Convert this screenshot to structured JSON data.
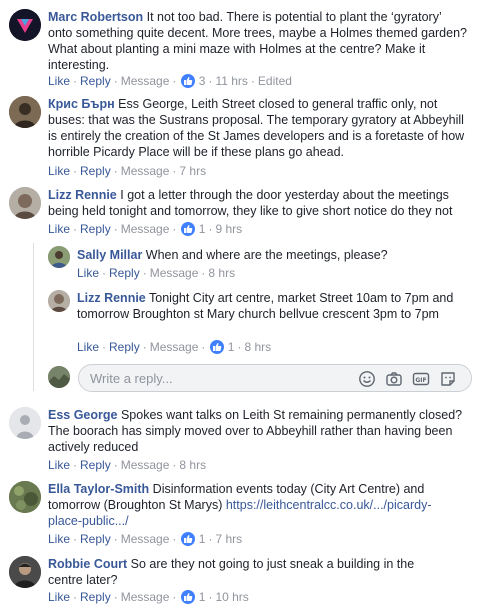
{
  "actions": {
    "like": "Like",
    "reply": "Reply",
    "message": "Message"
  },
  "comments": [
    {
      "author": "Marc Robertson",
      "text": "It not too bad. There is potential to plant the ‘gyratory’ onto something quite decent. More trees, maybe a Holmes themed garden? What about planting a mini maze with Holmes at the centre? Make it interesting.",
      "likes": "3",
      "time": "11 hrs",
      "edited": "Edited"
    },
    {
      "author": "Крис Бърн",
      "text": "Ess George, Leith Street closed to general traffic only, not buses: that was the Sustrans proposal. The temporary gyratory at Abbeyhill is entirely the creation of the St James developers and is a foretaste of how horrible Picardy Place will be if these plans go ahead.",
      "time": "7 hrs"
    },
    {
      "author": "Lizz Rennie",
      "text": "I got a letter through the door yesterday about the meetings being held tonight and tomorrow, they like to give short notice do they not",
      "likes": "1",
      "time": "9 hrs"
    },
    {
      "author": "Ess George",
      "text": "Spokes want talks on Leith St remaining permanently closed? The boorach has simply moved over to Abbeyhill rather than having been actively reduced",
      "time": "8 hrs"
    },
    {
      "author": "Ella Taylor-Smith",
      "text": "Disinformation events today (City Art Centre) and tomorrow (Broughton St Marys)",
      "link": "https://leithcentralcc.co.uk/.../picardy-place-public.../",
      "likes": "1",
      "time": "7 hrs"
    },
    {
      "author": "Robbie Court",
      "text": "So are they not going to just sneak a building in the centre later?",
      "likes": "1",
      "time": "10 hrs"
    }
  ],
  "replies": [
    {
      "author": "Sally Millar",
      "text": "When and where are the meetings, please?",
      "time": "8 hrs"
    },
    {
      "author": "Lizz Rennie",
      "text": "Tonight City art centre, market Street 10am to 7pm and tomorrow Broughton st Mary church bellvue crescent 3pm to 7pm",
      "likes": "1",
      "time": "8 hrs"
    }
  ],
  "reply_box": {
    "placeholder": "Write a reply..."
  },
  "colors": {
    "link": "#385898",
    "meta": "#90949c",
    "like_badge": "#4080ff"
  }
}
